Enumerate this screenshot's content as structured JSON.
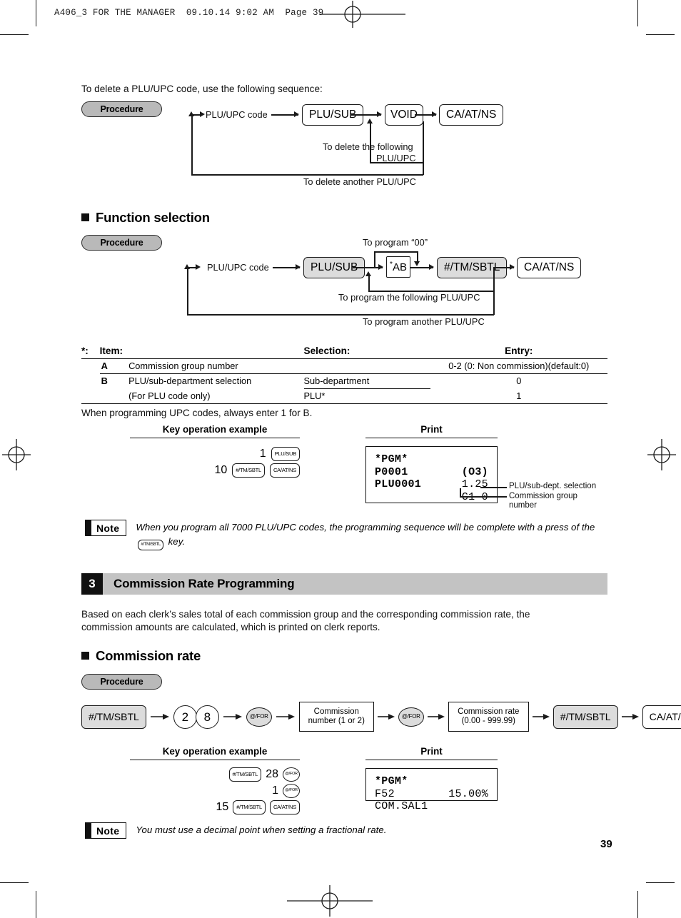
{
  "page_header": "A406_3 FOR THE MANAGER  09.10.14 9:02 AM  Page 39",
  "page_number": "39",
  "intro": {
    "delete_line": "To delete a PLU/UPC code, use the following sequence:"
  },
  "procedure_label": "Procedure",
  "delete_flow": {
    "input_label": "PLU/UPC code",
    "keys": [
      "PLU/SUB",
      "VOID",
      "CA/AT/NS"
    ],
    "loop_inner_line1": "To delete the following",
    "loop_inner_line2": "PLU/UPC",
    "loop_outer": "To delete another PLU/UPC"
  },
  "function_selection": {
    "heading": "Function selection",
    "input_label": "PLU/UPC code",
    "keys": [
      "PLU/SUB",
      "*AB",
      "#/TM/SBTL",
      "CA/AT/NS"
    ],
    "top_loop": "To program “00”",
    "loop_inner": "To program the following PLU/UPC",
    "loop_outer": "To program another PLU/UPC"
  },
  "spec_table": {
    "star": "*:",
    "headers": [
      "Item:",
      "Selection:",
      "Entry:"
    ],
    "rows": [
      {
        "key": "A",
        "item": "Commission group number",
        "selection": "",
        "entry": "0-2 (0: Non commission)(default:0)"
      },
      {
        "key": "B",
        "item": "PLU/sub-department selection",
        "selection": "Sub-department",
        "entry": "0"
      },
      {
        "key": "",
        "item": "(For PLU code only)",
        "selection": "PLU*",
        "entry": "1"
      }
    ],
    "footnote": "When programming UPC codes, always enter 1 for B."
  },
  "example1": {
    "key_head": "Key operation example",
    "print_head": "Print",
    "rows": [
      {
        "value": "1",
        "keys": [
          "PLU/SUB"
        ]
      },
      {
        "value": "10",
        "keys": [
          "#/TM/SBTL",
          "CA/AT/NS"
        ]
      }
    ],
    "print": {
      "title": "*PGM*",
      "lines": [
        {
          "left": "P0001",
          "right": "(O3)"
        },
        {
          "left": "PLU0001",
          "right": "1.25"
        },
        {
          "left": "",
          "right": "C1 0"
        }
      ]
    },
    "callouts": {
      "plu_sub_dept": "PLU/sub-dept. selection",
      "commission_group_l1": "Commission group",
      "commission_group_l2": "number"
    }
  },
  "note1": {
    "label": "Note",
    "text_before": "When you program all 7000 PLU/UPC codes, the programming sequence will be complete with a press of the",
    "key": "#/TM/SBTL",
    "text_after": "key."
  },
  "commission_section": {
    "number": "3",
    "title": "Commission Rate Programming",
    "description_l1": "Based on each clerk’s sales total of each commission group and the corresponding commission rate, the",
    "description_l2": "commission amounts are calculated, which is printed on clerk reports."
  },
  "commission_rate": {
    "heading": "Commission rate",
    "flow": [
      {
        "type": "key",
        "label": "#/TM/SBTL"
      },
      {
        "type": "circ",
        "label": "2"
      },
      {
        "type": "circ",
        "label": "8"
      },
      {
        "type": "circ",
        "label": "@/FOR"
      },
      {
        "type": "box",
        "l1": "Commission",
        "l2": "number (1 or 2)"
      },
      {
        "type": "circ",
        "label": "@/FOR"
      },
      {
        "type": "box",
        "l1": "Commission rate",
        "l2": "(0.00 - 999.99)"
      },
      {
        "type": "key",
        "label": "#/TM/SBTL"
      },
      {
        "type": "key",
        "label": "CA/AT/NS"
      }
    ]
  },
  "example2": {
    "key_head": "Key operation example",
    "print_head": "Print",
    "rows": [
      {
        "value": "",
        "keys": [
          "#/TM/SBTL"
        ],
        "num": "28",
        "trailing": [
          "@/FOR"
        ]
      },
      {
        "value": "",
        "keys": [],
        "num": "1",
        "trailing": [
          "@/FOR"
        ]
      },
      {
        "value": "15",
        "keys": [
          "#/TM/SBTL",
          "CA/AT/NS"
        ],
        "num": "",
        "trailing": []
      }
    ],
    "print": {
      "title": "*PGM*",
      "lines": [
        {
          "left": "F52 COM.SAL1",
          "right": "15.00%"
        }
      ]
    }
  },
  "note2": {
    "label": "Note",
    "text": "You must use a decimal point when setting a fractional rate."
  }
}
